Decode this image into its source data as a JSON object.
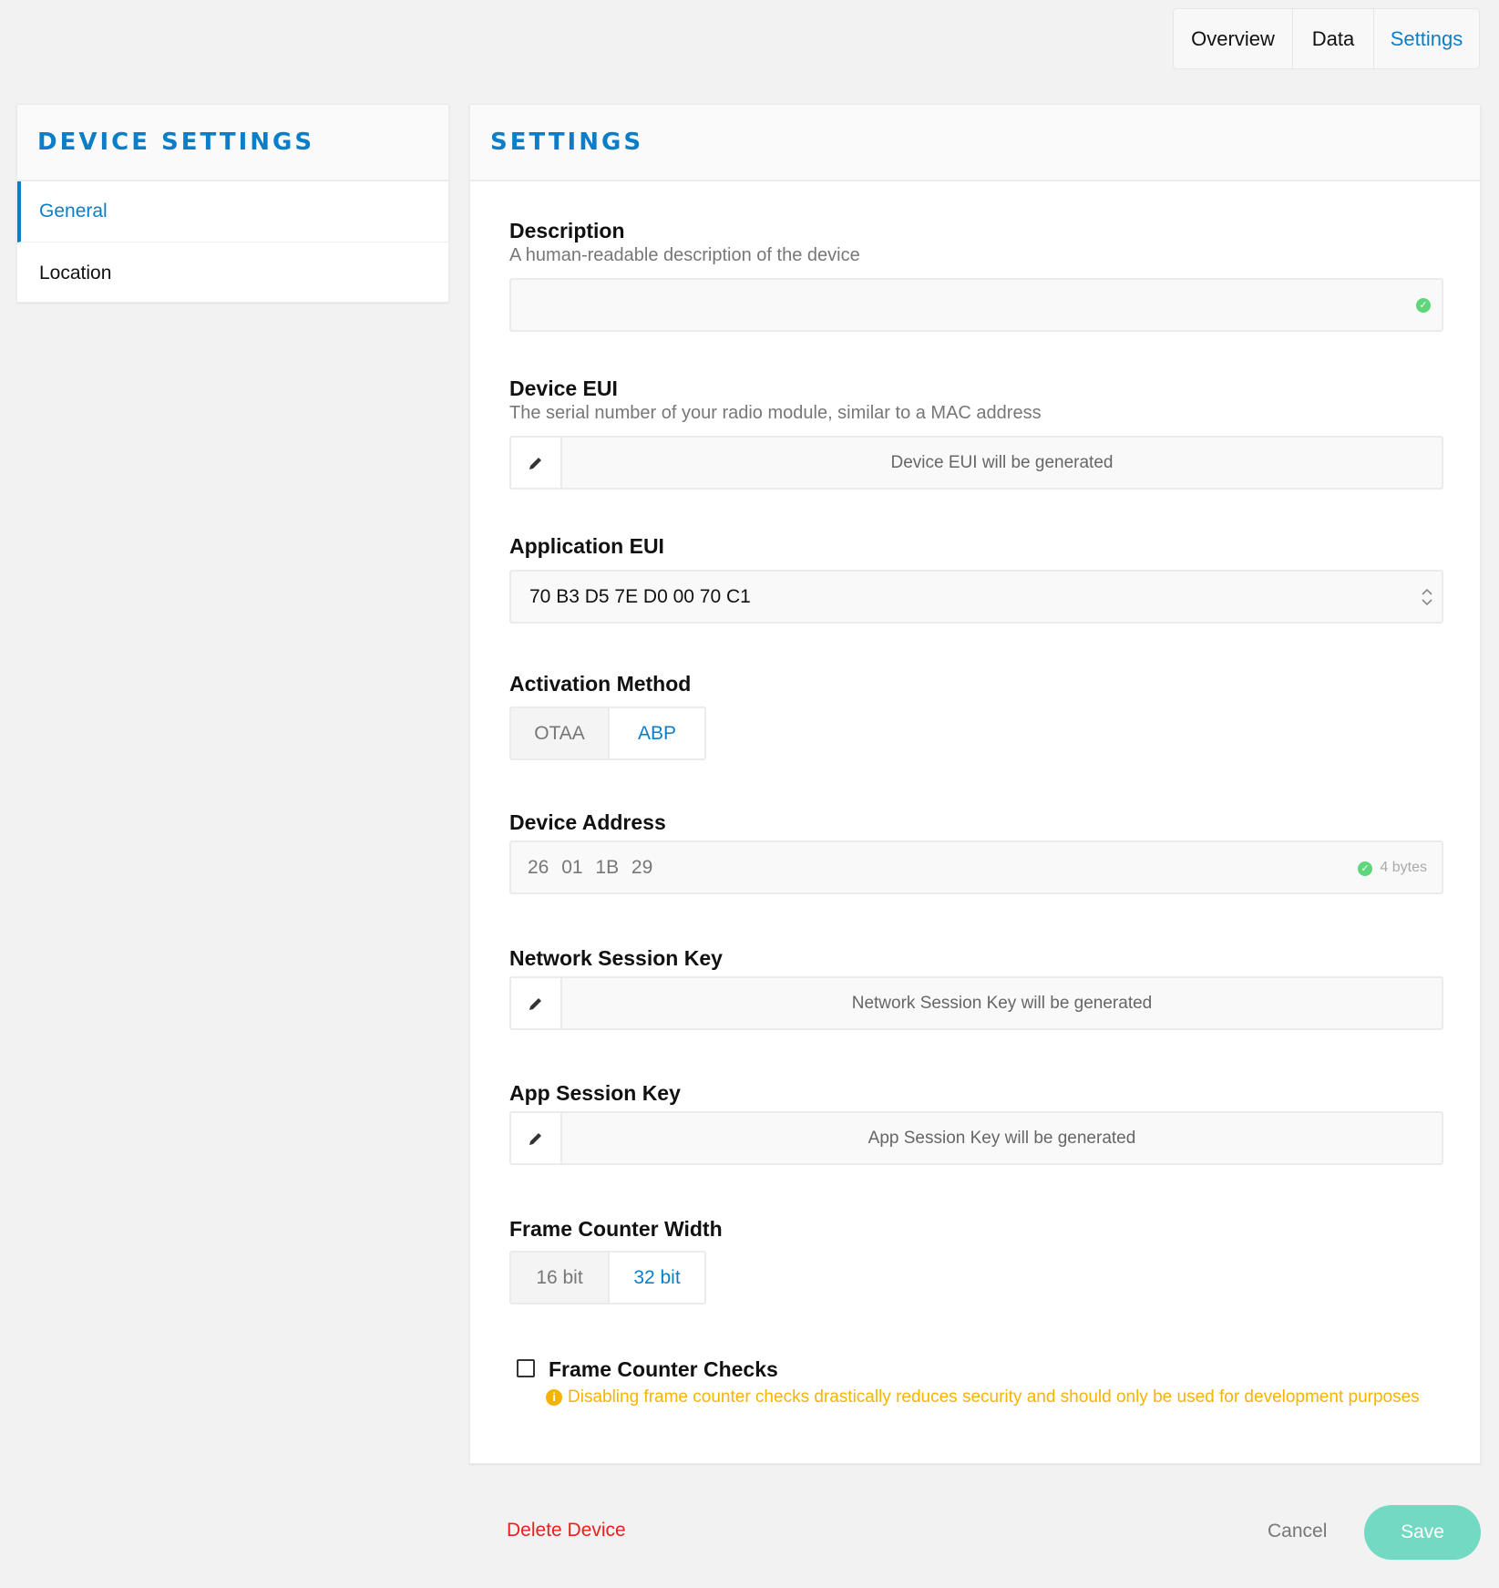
{
  "tabs": {
    "overview": "Overview",
    "data": "Data",
    "settings": "Settings",
    "active": "Settings"
  },
  "sidebar": {
    "title": "DEVICE SETTINGS",
    "items": [
      {
        "label": "General",
        "active": true
      },
      {
        "label": "Location",
        "active": false
      }
    ]
  },
  "settings": {
    "title": "SETTINGS",
    "description": {
      "label": "Description",
      "help": "A human-readable description of the device",
      "value": "",
      "status_icon": "check-circle-icon"
    },
    "device_eui": {
      "label": "Device EUI",
      "help": "The serial number of your radio module, similar to a MAC address",
      "placeholder": "Device EUI will be generated",
      "icon": "pencil-icon"
    },
    "application_eui": {
      "label": "Application EUI",
      "value": "70 B3 D5 7E D0 00 70 C1",
      "icon": "chevron-up-down-icon"
    },
    "activation_method": {
      "label": "Activation Method",
      "options": [
        "OTAA",
        "ABP"
      ],
      "selected": "ABP"
    },
    "device_address": {
      "label": "Device Address",
      "value": "26 01 1B 29",
      "size_hint": "4 bytes",
      "status_icon": "check-circle-icon"
    },
    "network_session_key": {
      "label": "Network Session Key",
      "placeholder": "Network Session Key will be generated",
      "icon": "pencil-icon"
    },
    "app_session_key": {
      "label": "App Session Key",
      "placeholder": "App Session Key will be generated",
      "icon": "pencil-icon"
    },
    "frame_counter_width": {
      "label": "Frame Counter Width",
      "options": [
        "16 bit",
        "32 bit"
      ],
      "selected": "32 bit"
    },
    "frame_counter_checks": {
      "label": "Frame Counter Checks",
      "checked": false,
      "warning": "Disabling frame counter checks drastically reduces security and should only be used for development purposes",
      "warning_icon": "info-circle-icon"
    }
  },
  "actions": {
    "delete": "Delete Device",
    "cancel": "Cancel",
    "save": "Save"
  },
  "colors": {
    "accent": "#0c7ec8",
    "danger": "#e8201f",
    "save": "#72d9c3",
    "warning": "#f5b400",
    "success": "#5fd67a"
  }
}
